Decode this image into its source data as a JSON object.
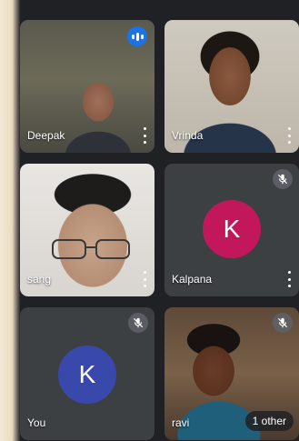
{
  "participants": [
    {
      "name": "Deepak"
    },
    {
      "name": "Vrinda"
    },
    {
      "name": "sang"
    },
    {
      "name": "Kalpana",
      "initial": "K"
    },
    {
      "name": "You",
      "initial": "K"
    },
    {
      "name": "ravi"
    }
  ],
  "others_badge": "1 other",
  "colors": {
    "kalpana_avatar": "#c2185b",
    "you_avatar": "#3949ab",
    "speaking_indicator": "#1a73e8"
  }
}
